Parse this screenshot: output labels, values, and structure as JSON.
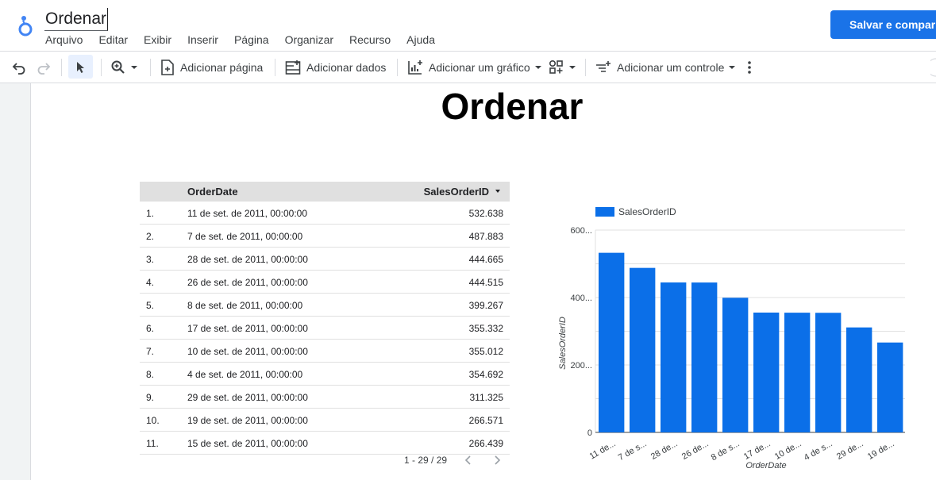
{
  "app": {
    "doc_title": "Ordenar",
    "menu": [
      "Arquivo",
      "Editar",
      "Exibir",
      "Inserir",
      "Página",
      "Organizar",
      "Recurso",
      "Ajuda"
    ],
    "save_label": "Salvar e compar"
  },
  "toolbar": {
    "add_page": "Adicionar página",
    "add_data": "Adicionar dados",
    "add_chart": "Adicionar um gráfico",
    "add_control": "Adicionar um controle"
  },
  "report": {
    "title": "Ordenar"
  },
  "table": {
    "headers": {
      "date": "OrderDate",
      "id": "SalesOrderID"
    },
    "rows": [
      {
        "idx": "1.",
        "date": "11 de set. de 2011, 00:00:00",
        "id": "532.638"
      },
      {
        "idx": "2.",
        "date": "7 de set. de 2011, 00:00:00",
        "id": "487.883"
      },
      {
        "idx": "3.",
        "date": "28 de set. de 2011, 00:00:00",
        "id": "444.665"
      },
      {
        "idx": "4.",
        "date": "26 de set. de 2011, 00:00:00",
        "id": "444.515"
      },
      {
        "idx": "5.",
        "date": "8 de set. de 2011, 00:00:00",
        "id": "399.267"
      },
      {
        "idx": "6.",
        "date": "17 de set. de 2011, 00:00:00",
        "id": "355.332"
      },
      {
        "idx": "7.",
        "date": "10 de set. de 2011, 00:00:00",
        "id": "355.012"
      },
      {
        "idx": "8.",
        "date": "4 de set. de 2011, 00:00:00",
        "id": "354.692"
      },
      {
        "idx": "9.",
        "date": "29 de set. de 2011, 00:00:00",
        "id": "311.325"
      },
      {
        "idx": "10.",
        "date": "19 de set. de 2011, 00:00:00",
        "id": "266.571"
      },
      {
        "idx": "11.",
        "date": "15 de set. de 2011, 00:00:00",
        "id": "266.439"
      }
    ],
    "pagination": "1 - 29 / 29"
  },
  "colors": {
    "accent": "#1a73e8",
    "bar": "#0b6fe8",
    "header_bg": "#e0e0e0"
  },
  "chart_data": {
    "type": "bar",
    "categories": [
      "11 de...",
      "7 de s...",
      "28 de...",
      "26 de...",
      "8 de s...",
      "17 de...",
      "10 de...",
      "4 de s...",
      "29 de...",
      "19 de..."
    ],
    "series": [
      {
        "name": "SalesOrderID",
        "values": [
          532.638,
          487.883,
          444.665,
          444.515,
          399.267,
          355.332,
          355.012,
          354.692,
          311.325,
          266.571
        ]
      }
    ],
    "xlabel": "OrderDate",
    "ylabel": "SalesOrderID",
    "yticks": [
      "0",
      "200...",
      "400...",
      "600..."
    ],
    "ylim": [
      0,
      600
    ],
    "grid": true,
    "legend": "top-left"
  }
}
